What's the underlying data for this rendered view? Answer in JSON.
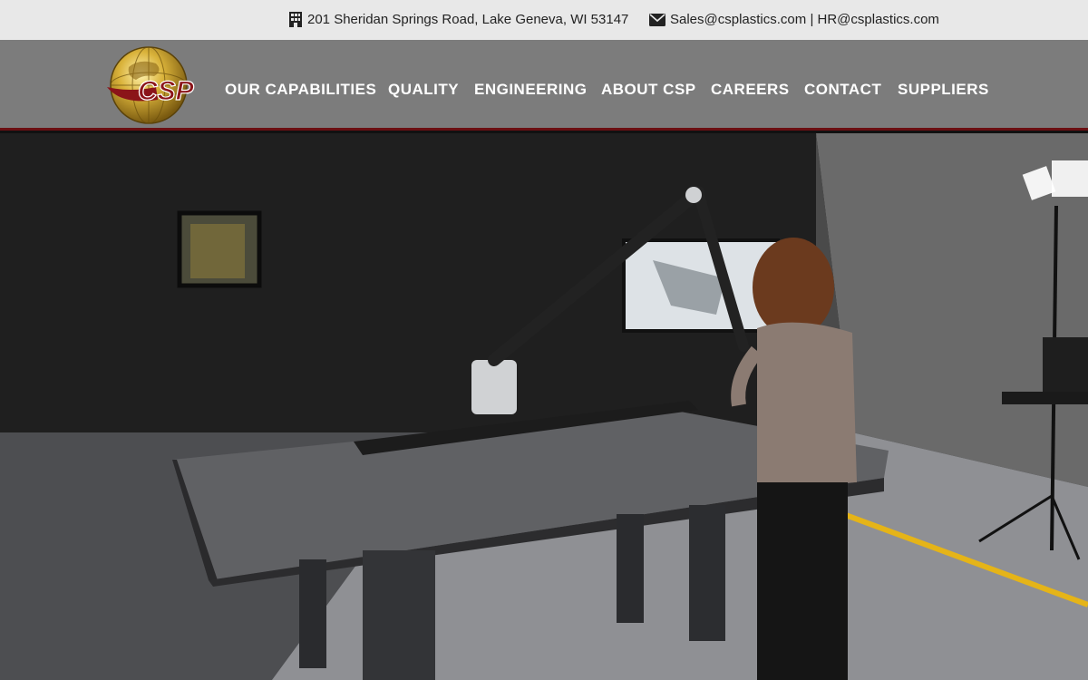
{
  "topbar": {
    "address": "201 Sheridan Springs Road, Lake Geneva, WI 53147",
    "emails": "Sales@csplastics.com | HR@csplastics.com"
  },
  "logo": {
    "text": "CSP",
    "icon": "globe-logo"
  },
  "nav": {
    "items": [
      {
        "label": "OUR CAPABILITIES"
      },
      {
        "label": "QUALITY"
      },
      {
        "label": "ENGINEERING"
      },
      {
        "label": "ABOUT CSP"
      },
      {
        "label": "CAREERS"
      },
      {
        "label": "CONTACT"
      },
      {
        "label": "SUPPLIERS"
      }
    ]
  },
  "icons": {
    "address": "building-icon",
    "email": "envelope-icon"
  },
  "colors": {
    "topbar_bg": "#e8e8e8",
    "nav_bg": "#7c7c7c",
    "accent": "#6b0f12",
    "logo_gold": "#c9a227",
    "logo_red": "#8b1419"
  }
}
